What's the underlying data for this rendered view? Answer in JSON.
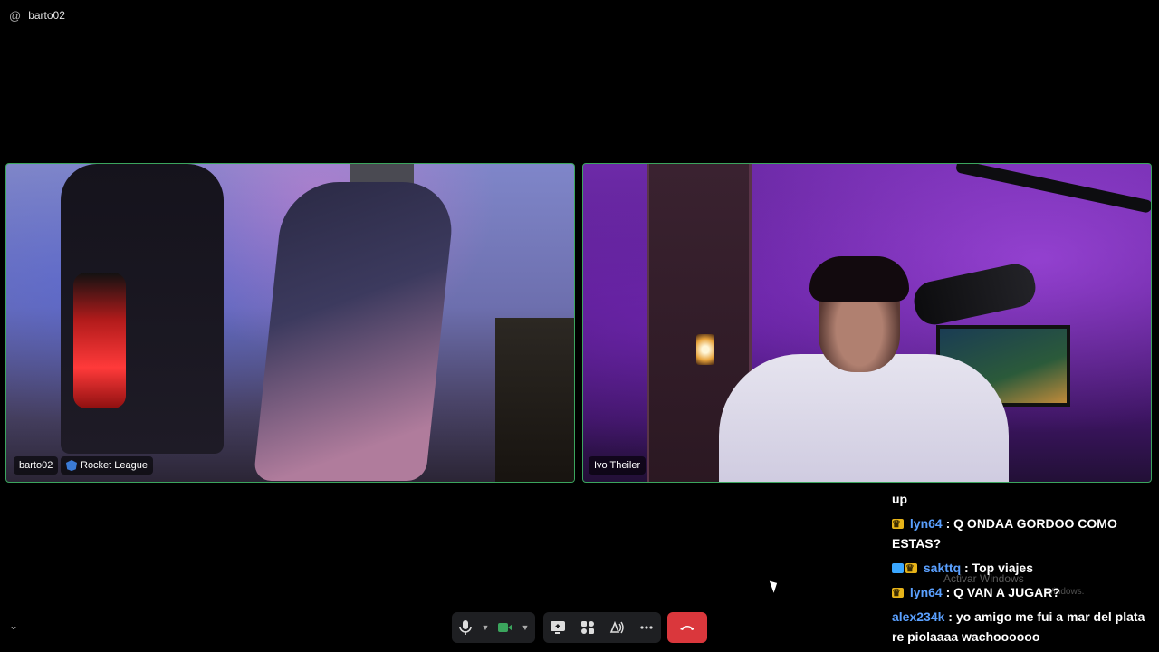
{
  "topbar": {
    "at_symbol": "@",
    "username": "barto02"
  },
  "tiles": {
    "left": {
      "name": "barto02",
      "game": "Rocket League"
    },
    "right": {
      "name": "Ivo Theiler"
    }
  },
  "chat": [
    {
      "text": "up"
    },
    {
      "badges": [
        "crown"
      ],
      "user": "lyn64",
      "message": " : Q ONDAA GORDOO COMO ESTAS?"
    },
    {
      "badges": [
        "blue",
        "crown"
      ],
      "user": "sakttq",
      "message": " : Top viajes"
    },
    {
      "badges": [
        "crown"
      ],
      "user": "lyn64",
      "message": " : Q VAN A JUGAR?"
    },
    {
      "user": "alex234k",
      "message": " : yo amigo me fui a mar del plata re piolaaaa wachoooooo"
    }
  ],
  "watermark": {
    "line1": "Activar Windows",
    "line2": "r Windows."
  },
  "controls": {
    "mic_icon": "microphone-icon",
    "camera_icon": "camera-icon",
    "share_icon": "screen-share-icon",
    "activities_icon": "activities-icon",
    "soundboard_icon": "soundboard-icon",
    "more_icon": "more-icon",
    "end_call_icon": "end-call-icon",
    "collapse_icon": "chevron-down-icon",
    "accent_green": "#3ba55d",
    "end_call_color": "#da373c"
  }
}
